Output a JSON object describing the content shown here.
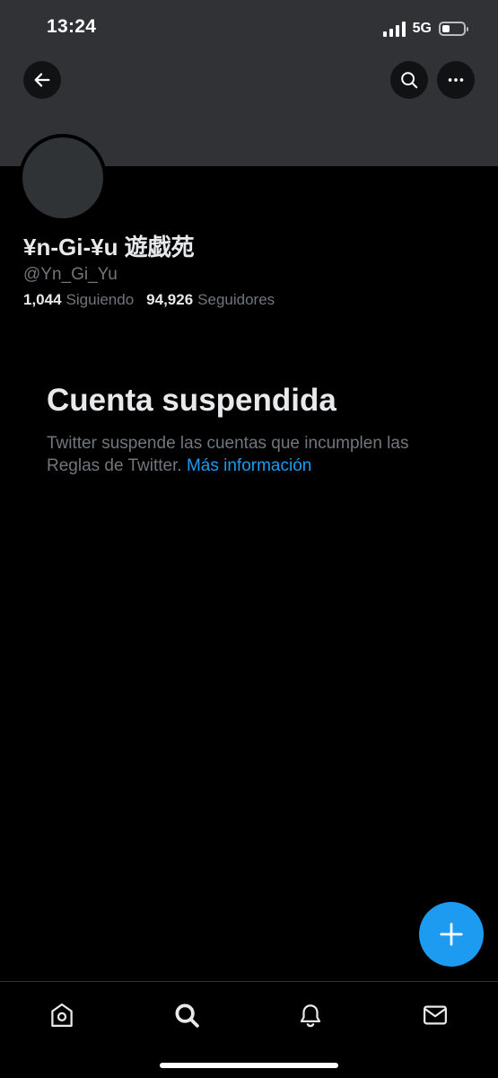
{
  "status_bar": {
    "time": "13:24",
    "network": "5G",
    "battery_level": 0.35
  },
  "header": {
    "back_icon": "arrow-left-icon",
    "search_icon": "search-icon",
    "more_icon": "more-horizontal-icon"
  },
  "profile": {
    "display_name": "¥n-Gi-¥u 遊戯苑",
    "handle": "@Yn_Gi_Yu",
    "following_count": "1,044",
    "following_label": "Siguiendo",
    "followers_count": "94,926",
    "followers_label": "Seguidores"
  },
  "suspended": {
    "title": "Cuenta suspendida",
    "body": "Twitter suspende las cuentas que incumplen las Reglas de Twitter.",
    "link_label": "Más información"
  },
  "fab": {
    "icon": "plus-icon"
  },
  "bottom_nav": {
    "items": [
      {
        "name": "home",
        "icon": "home-icon"
      },
      {
        "name": "search",
        "icon": "search-icon"
      },
      {
        "name": "notifications",
        "icon": "bell-icon"
      },
      {
        "name": "messages",
        "icon": "mail-icon"
      }
    ]
  },
  "colors": {
    "background": "#000000",
    "banner": "#303235",
    "accent": "#1d9bf0",
    "primary_text": "#e7e9ea",
    "secondary_text": "#71767b"
  }
}
